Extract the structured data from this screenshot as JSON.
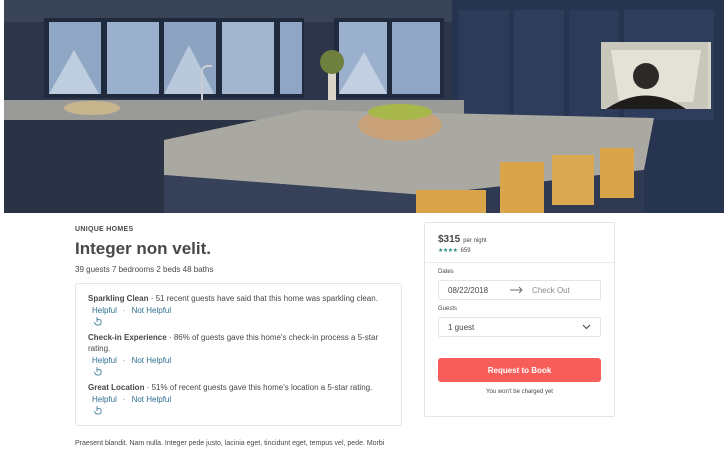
{
  "listing": {
    "category": "UNIQUE HOMES",
    "title": "Integer non velit.",
    "specs": "39 guests 7 bedrooms 2 beds 48 baths"
  },
  "highlights": [
    {
      "title": "Sparkling Clean",
      "text": " · 51 recent guests have said that this home was sparkling clean.",
      "helpful_label": "Helpful",
      "separator": "·",
      "not_helpful_label": "Not Helpful"
    },
    {
      "title": "Check-in Experience",
      "text": " · 86% of guests gave this home's check-in process a 5-star rating.",
      "helpful_label": "Helpful",
      "separator": "·",
      "not_helpful_label": "Not Helpful"
    },
    {
      "title": "Great Location",
      "text": " · 51% of recent guests gave this home's location a 5-star rating.",
      "helpful_label": "Helpful",
      "separator": "·",
      "not_helpful_label": "Not Helpful"
    }
  ],
  "description": "Praesent blandit. Nam nulla. Integer pede justo, lacinia eget, tincidunt eget, tempus vel, pede. Morbi",
  "booking": {
    "price": "$315",
    "per_night": "per night",
    "stars": "★★★★",
    "review_count": "659",
    "dates_label": "Dates",
    "check_in": "08/22/2018",
    "check_out_placeholder": "Check Out",
    "guests_label": "Guests",
    "guests_value": "1 guest",
    "request_button": "Request to Book",
    "note": "You won't be charged yet"
  },
  "colors": {
    "accent": "#f75e5a",
    "link": "#2f6f8f",
    "stars": "#2f8a8a",
    "text": "#484848"
  },
  "icons": {
    "hand": "pointing-hand-icon",
    "arrow": "arrow-right-icon",
    "chevron": "chevron-down-icon"
  }
}
